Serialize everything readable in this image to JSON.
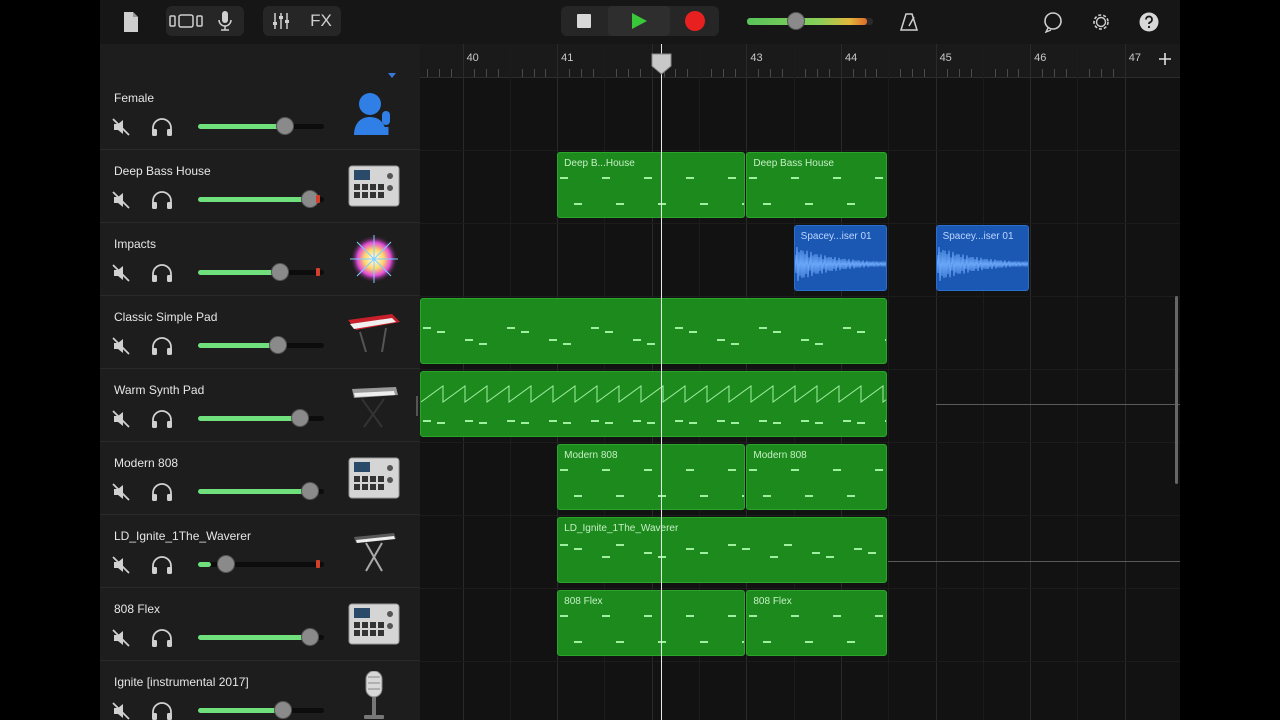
{
  "toolbar": {
    "fx_label": "FX",
    "accent_play": "#38c838",
    "accent_record": "#e82020",
    "master_volume_fraction": 0.4
  },
  "ruler": {
    "bars": [
      "40",
      "41",
      "42",
      "43",
      "44",
      "45",
      "46",
      "47"
    ],
    "playhead_bar": 42.1
  },
  "tracks": [
    {
      "name": "Female",
      "muted": true,
      "volume": 0.72,
      "instrument_icon": "female-vocal-icon",
      "lane_color": "none"
    },
    {
      "name": "Deep Bass House",
      "muted": true,
      "volume": 0.95,
      "instrument_icon": "beat-sequencer-icon"
    },
    {
      "name": "Impacts",
      "muted": true,
      "volume": 0.68,
      "instrument_icon": "sparkle-icon"
    },
    {
      "name": "Classic Simple Pad",
      "muted": true,
      "volume": 0.66,
      "instrument_icon": "red-keyboard-icon"
    },
    {
      "name": "Warm Synth Pad",
      "muted": true,
      "volume": 0.86,
      "instrument_icon": "synth-stand-icon"
    },
    {
      "name": "Modern 808",
      "muted": true,
      "volume": 0.95,
      "instrument_icon": "beat-sequencer-icon"
    },
    {
      "name": "LD_Ignite_1The_Waverer",
      "muted": true,
      "volume": 0.18,
      "instrument_icon": "keyboard-stand-icon"
    },
    {
      "name": "808 Flex",
      "muted": true,
      "volume": 0.95,
      "instrument_icon": "beat-sequencer-icon"
    },
    {
      "name": "Ignite [instrumental 2017]",
      "muted": true,
      "volume": 0.7,
      "instrument_icon": "microphone-icon"
    }
  ],
  "regions": [
    {
      "lane": 1,
      "type": "midi",
      "label": "Deep B...House",
      "start_bar": 41.0,
      "end_bar": 43.0
    },
    {
      "lane": 1,
      "type": "midi",
      "label": "Deep Bass House",
      "start_bar": 43.0,
      "end_bar": 44.5
    },
    {
      "lane": 2,
      "type": "audio",
      "label": "Spacey...iser 01",
      "start_bar": 43.5,
      "end_bar": 44.5
    },
    {
      "lane": 2,
      "type": "audio",
      "label": "Spacey...iser 01",
      "start_bar": 45.0,
      "end_bar": 46.0
    },
    {
      "lane": 3,
      "type": "midi",
      "label": "",
      "start_bar": 39.5,
      "end_bar": 44.5
    },
    {
      "lane": 4,
      "type": "midi",
      "label": "",
      "start_bar": 39.5,
      "end_bar": 44.5
    },
    {
      "lane": 5,
      "type": "midi",
      "label": "Modern 808",
      "start_bar": 41.0,
      "end_bar": 43.0
    },
    {
      "lane": 5,
      "type": "midi",
      "label": "Modern 808",
      "start_bar": 43.0,
      "end_bar": 44.5
    },
    {
      "lane": 6,
      "type": "midi",
      "label": "LD_Ignite_1The_Waverer",
      "start_bar": 41.0,
      "end_bar": 44.5
    },
    {
      "lane": 7,
      "type": "midi",
      "label": "808 Flex",
      "start_bar": 41.0,
      "end_bar": 43.0
    },
    {
      "lane": 7,
      "type": "midi",
      "label": "808 Flex",
      "start_bar": 43.0,
      "end_bar": 44.5
    }
  ]
}
